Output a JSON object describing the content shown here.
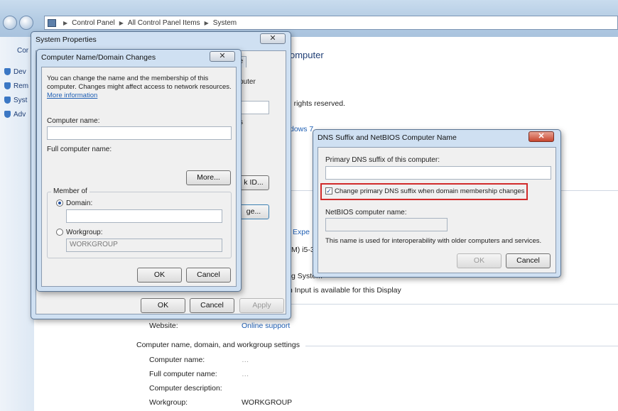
{
  "explorer": {
    "breadcrumb": [
      "Control Panel",
      "All Control Panel Items",
      "System"
    ],
    "left_items": [
      "Dev",
      "Rem",
      "Syst",
      "Adv"
    ],
    "left_header": "Cor"
  },
  "system_page": {
    "heading_fragment": "omputer",
    "rights": "ll rights reserved.",
    "windows_fragment": "dows 7",
    "experience_fragment": "Expe",
    "processor_fragment": "M) i5-3",
    "os_fragment": "g System",
    "pen_fragment": "h Input is available for this Display",
    "website_label": "Website:",
    "website_value": "Online support",
    "section_title": "Computer name, domain, and workgroup settings",
    "rows": [
      {
        "label": "Computer name:",
        "value": "…"
      },
      {
        "label": "Full computer name:",
        "value": "…"
      },
      {
        "label": "Computer description:",
        "value": ""
      },
      {
        "label": "Workgroup:",
        "value": "WORKGROUP"
      }
    ]
  },
  "sys_props": {
    "title": "System Properties",
    "tab": "mote",
    "frag_computer": "puter",
    "frag_s": "s",
    "id_button": "k ID...",
    "change_button": "ge...",
    "ok": "OK",
    "cancel": "Cancel",
    "apply": "Apply"
  },
  "name_changes": {
    "title": "Computer Name/Domain Changes",
    "description": "You can change the name and the membership of this computer. Changes might affect access to network resources.",
    "more_info": "More information",
    "computer_name_label": "Computer name:",
    "computer_name_value": "",
    "full_name_label": "Full computer name:",
    "full_name_value": "",
    "more_button": "More...",
    "member_of": "Member of",
    "domain_label": "Domain:",
    "domain_value": "",
    "workgroup_label": "Workgroup:",
    "workgroup_value": "WORKGROUP",
    "ok": "OK",
    "cancel": "Cancel"
  },
  "dns_dialog": {
    "title": "DNS Suffix and NetBIOS Computer Name",
    "primary_label": "Primary DNS suffix of this computer:",
    "primary_value": "",
    "checkbox_label": "Change primary DNS suffix when domain membership changes",
    "checkbox_checked": true,
    "netbios_label": "NetBIOS computer name:",
    "netbios_value": "",
    "note": "This name is used for interoperability with older computers and services.",
    "ok": "OK",
    "cancel": "Cancel",
    "highlight_color": "#d12b2b"
  }
}
